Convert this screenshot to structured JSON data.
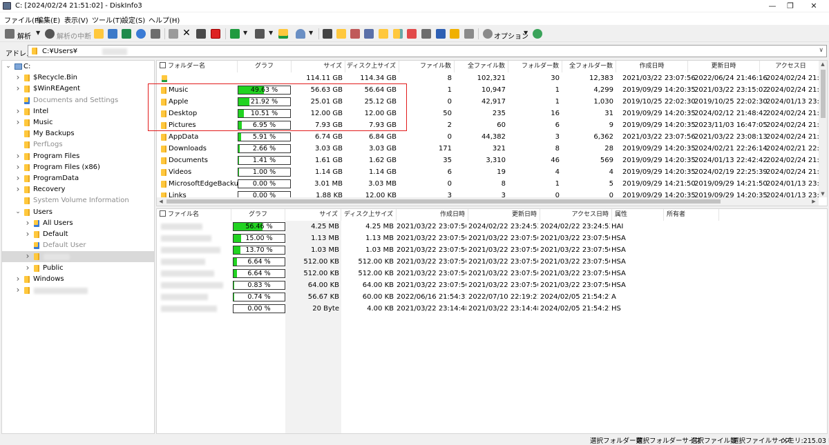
{
  "window": {
    "title": "C: [2024/02/24 21:51:02] - DiskInfo3"
  },
  "menu": [
    "ファイル(F)",
    "編集(E)",
    "表示(V)",
    "ツール(T)",
    "設定(S)",
    "ヘルプ(H)"
  ],
  "toolbar": {
    "analyze": "解析",
    "stop_analyze": "解析の中断",
    "options": "オプション"
  },
  "address": {
    "label": "アドレス",
    "path": "C:¥Users¥"
  },
  "tree": [
    {
      "label": "C:",
      "level": 0,
      "icon": "drive",
      "expanded": true
    },
    {
      "label": "$Recycle.Bin",
      "level": 1,
      "icon": "folder",
      "chevron": true
    },
    {
      "label": "$WinREAgent",
      "level": 1,
      "icon": "folder",
      "chevron": true
    },
    {
      "label": "Documents and Settings",
      "level": 1,
      "icon": "shortcut",
      "gray": true
    },
    {
      "label": "Intel",
      "level": 1,
      "icon": "folder",
      "chevron": true
    },
    {
      "label": "Music",
      "level": 1,
      "icon": "folder",
      "chevron": true
    },
    {
      "label": "My Backups",
      "level": 1,
      "icon": "folder"
    },
    {
      "label": "PerfLogs",
      "level": 1,
      "icon": "folder",
      "gray": true
    },
    {
      "label": "Program Files",
      "level": 1,
      "icon": "folder",
      "chevron": true
    },
    {
      "label": "Program Files (x86)",
      "level": 1,
      "icon": "folder",
      "chevron": true
    },
    {
      "label": "ProgramData",
      "level": 1,
      "icon": "folder",
      "chevron": true
    },
    {
      "label": "Recovery",
      "level": 1,
      "icon": "folder",
      "chevron": true
    },
    {
      "label": "System Volume Information",
      "level": 1,
      "icon": "folder",
      "gray": true
    },
    {
      "label": "Users",
      "level": 1,
      "icon": "folder",
      "expanded": true
    },
    {
      "label": "All Users",
      "level": 2,
      "icon": "shortcut",
      "chevron": true
    },
    {
      "label": "Default",
      "level": 2,
      "icon": "folder",
      "chevron": true
    },
    {
      "label": "Default User",
      "level": 2,
      "icon": "shortcut",
      "gray": true
    },
    {
      "label": "",
      "level": 2,
      "icon": "folder",
      "chevron": true,
      "selected": true,
      "blur": 38
    },
    {
      "label": "Public",
      "level": 2,
      "icon": "folder",
      "chevron": true
    },
    {
      "label": "Windows",
      "level": 1,
      "icon": "folder",
      "chevron": true
    },
    {
      "label": "",
      "level": 1,
      "icon": "folder",
      "chevron": true,
      "blur": 78
    }
  ],
  "folders": {
    "columns": [
      "フォルダー名",
      "グラフ",
      "サイズ",
      "ディスク上サイズ",
      "ファイル数",
      "全ファイル数",
      "フォルダー数",
      "全フォルダー数",
      "作成日時",
      "更新日時",
      "アクセス日"
    ],
    "rows": [
      {
        "name": "",
        "up": true,
        "graph": null,
        "size": "114.11 GB",
        "disk": "114.34 GB",
        "files": "8",
        "allfiles": "102,321",
        "folders": "30",
        "allfolders": "12,383",
        "created": "2021/03/22 23:07:56",
        "modified": "2022/06/24 21:46:16",
        "accessed": "2024/02/24 21:16"
      },
      {
        "name": "Music",
        "graph": 49.63,
        "graph_label": "49.63 %",
        "size": "56.63 GB",
        "disk": "56.64 GB",
        "files": "1",
        "allfiles": "10,947",
        "folders": "1",
        "allfolders": "4,299",
        "created": "2019/09/29 14:20:35",
        "modified": "2021/03/22 23:15:02",
        "accessed": "2024/02/24 21:16"
      },
      {
        "name": "Apple",
        "graph": 21.92,
        "graph_label": "21.92 %",
        "size": "25.01 GB",
        "disk": "25.12 GB",
        "files": "0",
        "allfiles": "42,917",
        "folders": "1",
        "allfolders": "1,030",
        "created": "2019/10/25 22:02:30",
        "modified": "2019/10/25 22:02:30",
        "accessed": "2024/01/13 23:1"
      },
      {
        "name": "Desktop",
        "graph": 10.51,
        "graph_label": "10.51 %",
        "size": "12.00 GB",
        "disk": "12.00 GB",
        "files": "50",
        "allfiles": "235",
        "folders": "16",
        "allfolders": "31",
        "created": "2019/09/29 14:20:35",
        "modified": "2024/02/12 21:48:42",
        "accessed": "2024/02/24 21:16"
      },
      {
        "name": "Pictures",
        "graph": 6.95,
        "graph_label": "6.95 %",
        "size": "7.93 GB",
        "disk": "7.93 GB",
        "files": "2",
        "allfiles": "60",
        "folders": "6",
        "allfolders": "9",
        "created": "2019/09/29 14:20:35",
        "modified": "2023/11/03 16:47:05",
        "accessed": "2024/02/24 21:16"
      },
      {
        "name": "AppData",
        "graph": 5.91,
        "graph_label": "5.91 %",
        "size": "6.74 GB",
        "disk": "6.84 GB",
        "files": "0",
        "allfiles": "44,382",
        "folders": "3",
        "allfolders": "6,362",
        "created": "2021/03/22 23:07:56",
        "modified": "2021/03/22 23:08:13",
        "accessed": "2024/02/24 21:16"
      },
      {
        "name": "Downloads",
        "graph": 2.66,
        "graph_label": "2.66 %",
        "size": "3.03 GB",
        "disk": "3.03 GB",
        "files": "171",
        "allfiles": "321",
        "folders": "8",
        "allfolders": "28",
        "created": "2019/09/29 14:20:35",
        "modified": "2024/02/21 22:26:14",
        "accessed": "2024/02/21 22:2"
      },
      {
        "name": "Documents",
        "graph": 1.41,
        "graph_label": "1.41 %",
        "size": "1.61 GB",
        "disk": "1.62 GB",
        "files": "35",
        "allfiles": "3,310",
        "folders": "46",
        "allfolders": "569",
        "created": "2019/09/29 14:20:35",
        "modified": "2024/01/13 22:42:42",
        "accessed": "2024/02/24 21:16"
      },
      {
        "name": "Videos",
        "graph": 1.0,
        "graph_label": "1.00 %",
        "size": "1.14 GB",
        "disk": "1.14 GB",
        "files": "6",
        "allfiles": "19",
        "folders": "4",
        "allfolders": "4",
        "created": "2019/09/29 14:20:35",
        "modified": "2024/02/19 22:25:39",
        "accessed": "2024/02/24 21:16"
      },
      {
        "name": "MicrosoftEdgeBackups",
        "graph": 0.0,
        "graph_label": "0.00 %",
        "size": "3.01 MB",
        "disk": "3.03 MB",
        "files": "0",
        "allfiles": "8",
        "folders": "1",
        "allfolders": "5",
        "created": "2019/09/29 14:21:50",
        "modified": "2019/09/29 14:21:50",
        "accessed": "2024/01/13 23:1"
      },
      {
        "name": "Links",
        "graph": 0.0,
        "graph_label": "0.00 %",
        "size": "1.88 KB",
        "disk": "12.00 KB",
        "files": "3",
        "allfiles": "3",
        "folders": "0",
        "allfolders": "0",
        "created": "2019/09/29 14:20:35",
        "modified": "2019/09/29 14:20:35",
        "accessed": "2024/01/13 23:1"
      }
    ]
  },
  "files": {
    "columns": [
      "ファイル名",
      "グラフ",
      "サイズ",
      "ディスク上サイズ",
      "作成日時",
      "更新日時",
      "アクセス日時",
      "属性",
      "所有者"
    ],
    "rows": [
      {
        "graph": 56.46,
        "graph_label": "56.46 %",
        "size": "4.25 MB",
        "disk": "4.25 MB",
        "created": "2021/03/22 23:07:56",
        "modified": "2024/02/22 23:24:53",
        "accessed": "2024/02/22 23:24:53",
        "attr": "HAI"
      },
      {
        "graph": 15.0,
        "graph_label": "15.00 %",
        "size": "1.13 MB",
        "disk": "1.13 MB",
        "created": "2021/03/22 23:07:56",
        "modified": "2021/03/22 23:07:56",
        "accessed": "2021/03/22 23:07:56",
        "attr": "HSA"
      },
      {
        "graph": 13.7,
        "graph_label": "13.70 %",
        "size": "1.03 MB",
        "disk": "1.03 MB",
        "created": "2021/03/22 23:07:56",
        "modified": "2021/03/22 23:07:56",
        "accessed": "2021/03/22 23:07:56",
        "attr": "HSA"
      },
      {
        "graph": 6.64,
        "graph_label": "6.64 %",
        "size": "512.00 KB",
        "disk": "512.00 KB",
        "created": "2021/03/22 23:07:56",
        "modified": "2021/03/22 23:07:56",
        "accessed": "2021/03/22 23:07:56",
        "attr": "HSA"
      },
      {
        "graph": 6.64,
        "graph_label": "6.64 %",
        "size": "512.00 KB",
        "disk": "512.00 KB",
        "created": "2021/03/22 23:07:56",
        "modified": "2021/03/22 23:07:56",
        "accessed": "2021/03/22 23:07:56",
        "attr": "HSA"
      },
      {
        "graph": 0.83,
        "graph_label": "0.83 %",
        "size": "64.00 KB",
        "disk": "64.00 KB",
        "created": "2021/03/22 23:07:56",
        "modified": "2021/03/22 23:07:56",
        "accessed": "2021/03/22 23:07:56",
        "attr": "HSA"
      },
      {
        "graph": 0.74,
        "graph_label": "0.74 %",
        "size": "56.67 KB",
        "disk": "60.00 KB",
        "created": "2022/06/16 21:54:31",
        "modified": "2022/07/10 22:19:21",
        "accessed": "2024/02/05 21:54:21",
        "attr": "A"
      },
      {
        "graph": 0.0,
        "graph_label": "0.00 %",
        "size": "20 Byte",
        "disk": "4.00 KB",
        "created": "2021/03/22 23:14:48",
        "modified": "2021/03/22 23:14:48",
        "accessed": "2024/02/05 21:54:21",
        "attr": "HS"
      }
    ]
  },
  "status": [
    "選択フォルダー数",
    "選択フォルダーサイズ",
    "選択ファイル数",
    "選択ファイルサイズ",
    "メモリ:215.03 MB"
  ],
  "colors": {
    "bar_fill": "#22d322",
    "highlight_box": "#e21a1a",
    "selection": "#d9d9d9"
  }
}
